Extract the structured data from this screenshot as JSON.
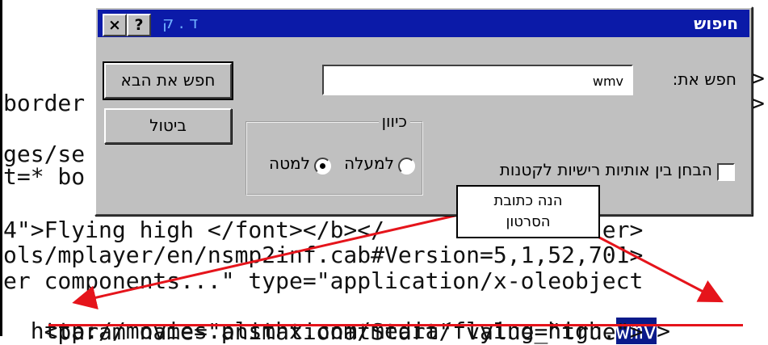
{
  "background_code": {
    "left_fragments": [
      {
        "text": "border"
      },
      {
        "text": "ges/se"
      },
      {
        "text": "t=* bo"
      }
    ],
    "right_fragments": [
      {
        "text": ">"
      },
      {
        "text": ">"
      }
    ],
    "lines": [
      {
        "text": "4\">Flying high </font></b></         r><center>"
      },
      {
        "text": "ols/mplayer/en/nsmp2inf.cab#Version=5,1,52,701>"
      },
      {
        "text": "er components...\" type=\"application/x-oleobject"
      },
      {
        "text_before": "http://movies.plsthx.com/media/flying_high.",
        "selected": "wmv",
        "text_after": ">"
      },
      {
        "text": "   <param name=\"animationatStart\" value=\"true\">"
      }
    ]
  },
  "dialog": {
    "title": "חיפוש",
    "title_hint": "ד . ק",
    "help_button": "?",
    "close_button": "×",
    "find_label": "חפש את:",
    "find_value": "wmv",
    "find_next_button": "חפש את הבא",
    "cancel_button": "ביטול",
    "direction_group": "כיוון",
    "direction_up": "למעלה",
    "direction_down": "למטה",
    "direction_selected": "up",
    "match_case_label": "הבחן בין אותיות רישיות לקטנות",
    "match_case_checked": false
  },
  "callout": {
    "line1": "הנה כתובת",
    "line2": "הסרטון"
  },
  "colors": {
    "titlebar": "#0b1aa8",
    "selection": "#0a1a8a",
    "annotation": "#e5141b",
    "dialog_face": "#c0c0c0"
  }
}
